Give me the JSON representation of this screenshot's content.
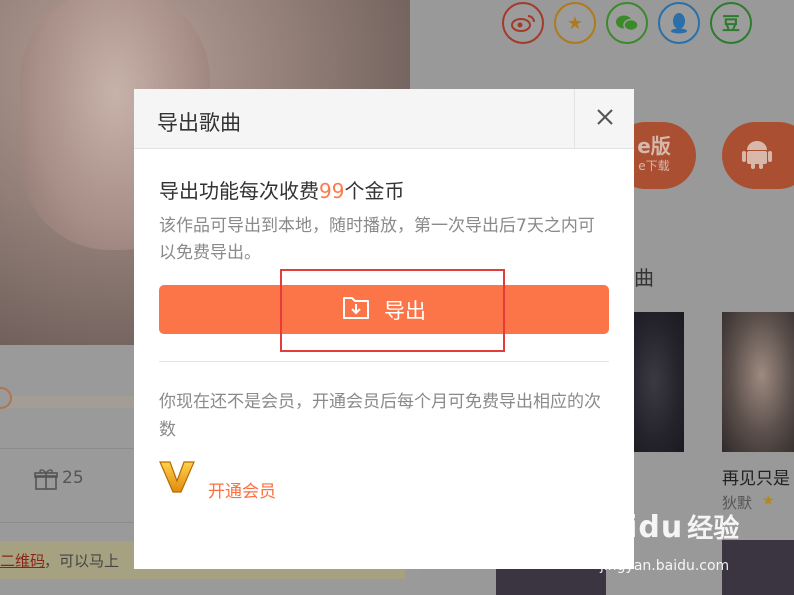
{
  "background": {
    "gift_count": "25",
    "qr_link": "二维码",
    "qr_tail": "，可以马上",
    "right_column_title": "曲",
    "pill_text": "e版",
    "pill_sub": "e下载",
    "song": {
      "title": "再见只是",
      "artist": "狄默"
    },
    "social_icons": [
      "weibo-icon",
      "star-icon",
      "wechat-icon",
      "qq-icon",
      "douban-icon"
    ],
    "douban_glyph": "豆"
  },
  "dialog": {
    "title": "导出歌曲",
    "headline_prefix": "导出功能每次收费",
    "headline_price": "99",
    "headline_suffix": "个金币",
    "description": "该作品可导出到本地，随时播放，第一次导出后7天之内可以免费导出。",
    "export_label": "导出",
    "member_notice": "你现在还不是会员，开通会员后每个月可免费导出相应的次数",
    "member_link": "开通会员"
  },
  "watermark": {
    "brand": "Baidu",
    "brand_cn": "经验",
    "url": "jingyan.baidu.com"
  },
  "colors": {
    "accent": "#fc7549",
    "price": "#ff7a4a",
    "highlight": "#e23c3c"
  }
}
